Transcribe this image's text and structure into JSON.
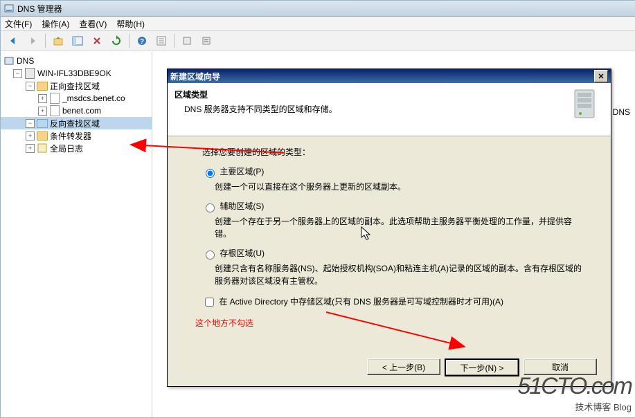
{
  "window": {
    "title": "DNS 管理器"
  },
  "menu": {
    "file": "文件(F)",
    "action": "操作(A)",
    "view": "查看(V)",
    "help": "帮助(H)"
  },
  "tree": {
    "root": "DNS",
    "server": "WIN-IFL33DBE9OK",
    "fwd": "正向查找区域",
    "fwd1": "_msdcs.benet.co",
    "fwd2": "benet.com",
    "rev": "反向查找区域",
    "cond": "条件转发器",
    "log": "全局日志"
  },
  "rightpane": {
    "label": "DNS"
  },
  "dialog": {
    "title": "新建区域向导",
    "header_title": "区域类型",
    "header_desc": "DNS 服务器支持不同类型的区域和存储。",
    "prompt": "选择您要创建的区域的类型：",
    "opt1_label": "主要区域(P)",
    "opt1_desc": "创建一个可以直接在这个服务器上更新的区域副本。",
    "opt2_label": "辅助区域(S)",
    "opt2_desc": "创建一个存在于另一个服务器上的区域的副本。此选项帮助主服务器平衡处理的工作量，并提供容错。",
    "opt3_label": "存根区域(U)",
    "opt3_desc": "创建只含有名称服务器(NS)、起始授权机构(SOA)和粘连主机(A)记录的区域的副本。含有存根区域的服务器对该区域没有主管权。",
    "chk_label": "在 Active Directory 中存储区域(只有 DNS 服务器是可写域控制器时才可用)(A)",
    "annotation": "这个地方不勾选",
    "btn_back": "< 上一步(B)",
    "btn_next": "下一步(N) >",
    "btn_cancel": "取消"
  },
  "watermark": {
    "big": "51CTO.com",
    "small": "技术博客    Blog"
  }
}
